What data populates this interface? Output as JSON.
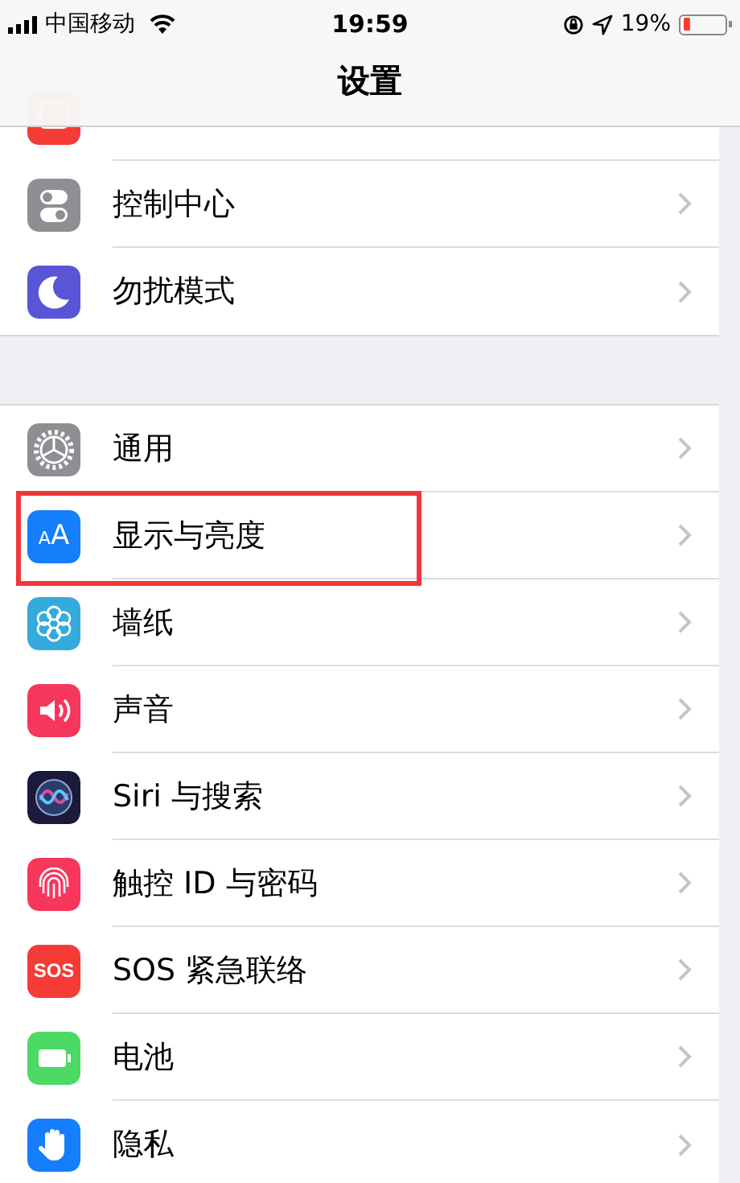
{
  "status_bar": {
    "carrier": "中国移动",
    "time": "19:59",
    "battery_percent": "19%",
    "battery": {
      "level": 0.19
    }
  },
  "nav_bar": {
    "title": "设置"
  },
  "groups": [
    {
      "rows": [
        {
          "kind": "notifications"
        },
        {
          "kind": "control",
          "label": "控制中心",
          "highlighted": false
        },
        {
          "kind": "moon",
          "label": "勿扰模式",
          "highlighted": false
        }
      ]
    },
    {
      "rows": [
        {
          "kind": "gear",
          "label": "通用",
          "highlighted": false
        },
        {
          "kind": "display",
          "label": "显示与亮度",
          "highlighted": true,
          "icon_text": [
            "A",
            "A"
          ]
        },
        {
          "kind": "wallpaper",
          "label": "墙纸",
          "highlighted": false
        },
        {
          "kind": "sound",
          "label": "声音",
          "highlighted": false
        },
        {
          "kind": "siri",
          "label": "Siri 与搜索",
          "highlighted": false
        },
        {
          "kind": "touchid",
          "label": "触控 ID 与密码",
          "highlighted": false
        },
        {
          "kind": "sos",
          "label": "SOS 紧急联络",
          "highlighted": false,
          "icon_text": [
            "SOS"
          ]
        },
        {
          "kind": "battery",
          "label": "电池",
          "highlighted": false
        },
        {
          "kind": "privacy",
          "label": "隐私",
          "highlighted": false
        }
      ]
    }
  ]
}
